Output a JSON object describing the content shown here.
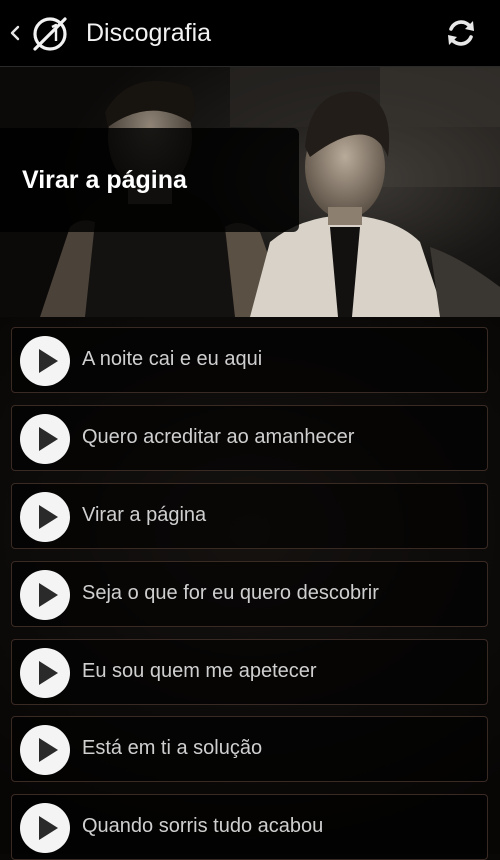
{
  "header": {
    "title": "Discografia",
    "back_icon": "chevron-left-icon",
    "logo_icon": "app-logo-icon",
    "refresh_icon": "refresh-icon"
  },
  "banner": {
    "caption": "Virar a página"
  },
  "tracks": [
    {
      "label": "A noite cai e eu aqui",
      "icon": "play-icon"
    },
    {
      "label": "Quero acreditar ao amanhecer",
      "icon": "play-icon"
    },
    {
      "label": "Virar a página",
      "icon": "play-icon"
    },
    {
      "label": "Seja o que for eu quero descobrir",
      "icon": "play-icon"
    },
    {
      "label": "Eu sou quem me apetecer",
      "icon": "play-icon"
    },
    {
      "label": "Está em ti a solução",
      "icon": "play-icon"
    },
    {
      "label": "Quando sorris tudo acabou",
      "icon": "play-icon"
    }
  ],
  "colors": {
    "background": "#0a0807",
    "actionbar": "#000000",
    "track_border": "#3a2a24",
    "play_button": "#f4f4f4"
  }
}
